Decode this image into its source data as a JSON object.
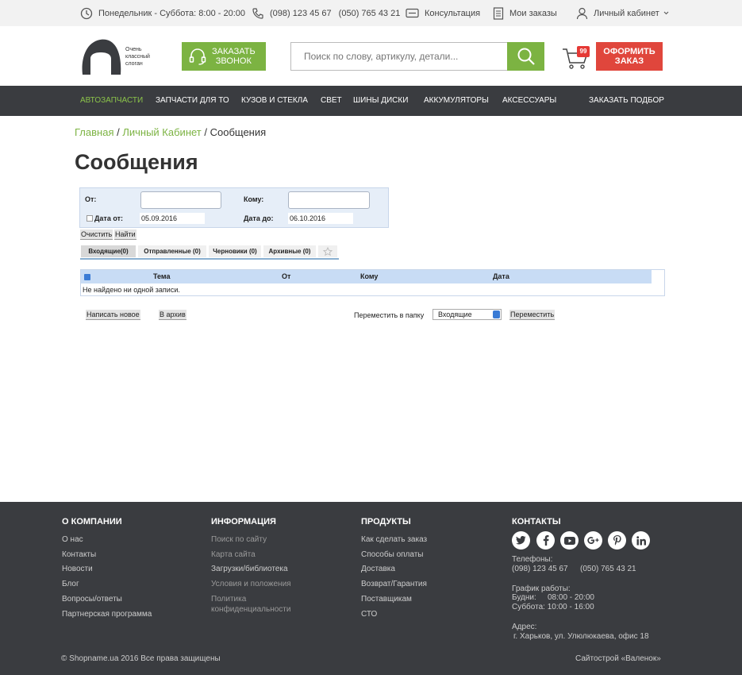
{
  "topbar": {
    "hours": "Понедельник - Суббота: 8:00 - 20:00",
    "phone1": "(098) 123 45 67",
    "phone2": "(050) 765 43 21",
    "consultation": "Консультация",
    "my_orders": "Мои заказы",
    "account": "Личный кабинет"
  },
  "header": {
    "slogan_line1": "Очень",
    "slogan_line2": "классный",
    "slogan_line3": "слоган",
    "callback_line1": "Заказать",
    "callback_line2": "звонок",
    "search_placeholder": "Поиск по слову, артикулу, детали...",
    "cart_count": "99",
    "checkout_line1": "Оформить",
    "checkout_line2": "заказ"
  },
  "nav": {
    "items": [
      "Автозапчасти",
      "Запчасти для ТО",
      "Кузов и стекла",
      "Свет",
      "Шины диски",
      "Аккумуляторы",
      "Аксессуары"
    ],
    "right": "Заказать подбор"
  },
  "breadcrumb": {
    "home": "Главная",
    "cabinet": "Личный Кабинет",
    "current": "Сообщения"
  },
  "page_title": "Сообщения",
  "filter": {
    "from_label": "От:",
    "to_label": "Кому:",
    "date_from_label": "Дата от:",
    "date_from_value": "05.09.2016",
    "date_to_label": "Дата до:",
    "date_to_value": "06.10.2016",
    "clear": "Очистить",
    "find": "Найти"
  },
  "tabs": [
    "Входящие(0)",
    "Отправленные (0)",
    "Черновики (0)",
    "Архивные (0)"
  ],
  "table": {
    "columns": [
      "Тема",
      "От",
      "Кому",
      "Дата"
    ],
    "empty": "Не найдено ни одной записи."
  },
  "actions": {
    "compose": "Написать новое",
    "archive": "В архив",
    "move_label": "Переместить в папку",
    "folder": "Входящие",
    "move": "Переместить"
  },
  "footer": {
    "company": {
      "title": "О компании",
      "links": [
        "О нас",
        "Контакты",
        "Новости",
        "Блог",
        "Вопросы/ответы",
        "Партнерская программа"
      ]
    },
    "info": {
      "title": "Информация",
      "links": [
        "Поиск по сайту",
        "Карта сайта",
        "Загрузки/библиотека",
        "Условия и положения",
        "Политика",
        "конфиденциальности"
      ]
    },
    "products": {
      "title": "Продукты",
      "links": [
        "Как сделать заказ",
        "Способы оплаты",
        "Доставка",
        "Возврат/Гарантия",
        "Поставщикам",
        "СТО"
      ]
    },
    "contacts": {
      "title": "Контакты",
      "phones_label": "Телефоны:",
      "phone1": "(098) 123 45 67",
      "phone2": "(050) 765 43 21",
      "schedule_label": "График работы:",
      "weekdays": "Будни:",
      "weekdays_time": "08:00 - 20:00",
      "saturday": "Суббота: 10:00 - 16:00",
      "address_label": "Адрес:",
      "address": "г. Харьков, ул. Улюлюкаева, офис 18"
    },
    "copyright": "© Shopname.ua 2016 Все права защищены",
    "credit": "Сайтострой «Валенок»"
  }
}
